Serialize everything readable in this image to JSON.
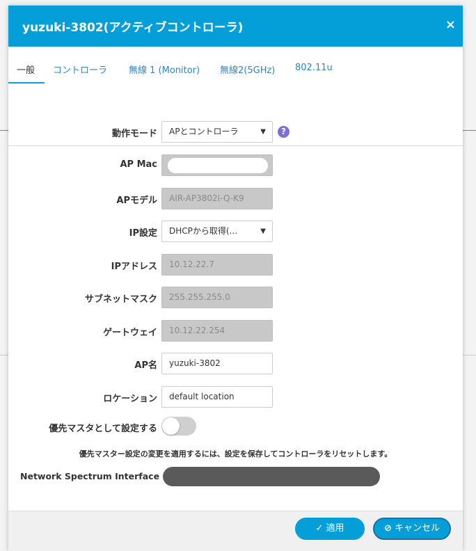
{
  "dialog": {
    "title": "yuzuki-3802(アクティブコントローラ)",
    "close_icon": "×"
  },
  "tabs": [
    {
      "label": "一般",
      "active": true
    },
    {
      "label": "コントローラ"
    },
    {
      "label": "無線 1 (Monitor)"
    },
    {
      "label": "無線2(5GHz)"
    },
    {
      "label": "802.11u"
    }
  ],
  "form": {
    "operation_mode": {
      "label": "動作モード",
      "value": "APとコントローラ"
    },
    "help_icon": "?",
    "ap_mac": {
      "label": "AP Mac",
      "value": ""
    },
    "ap_model": {
      "label": "APモデル",
      "value": "AIR-AP3802I-Q-K9"
    },
    "ip_setting": {
      "label": "IP設定",
      "value": "DHCPから取得(..."
    },
    "ip_address": {
      "label": "IPアドレス",
      "value": "10.12.22.7"
    },
    "subnet_mask": {
      "label": "サブネットマスク",
      "value": "255.255.255.0"
    },
    "gateway": {
      "label": "ゲートウェイ",
      "value": "10.12.22.254"
    },
    "ap_name": {
      "label": "AP名",
      "value": "yuzuki-3802"
    },
    "location": {
      "label": "ロケーション",
      "value": "default location"
    },
    "preferred_master": {
      "label": "優先マスタとして設定する",
      "enabled": false
    },
    "note": "優先マスター設定の変更を適用するには、設定を保存してコントローラをリセットします。",
    "network_spectrum_interface": {
      "label": "Network Spectrum Interface",
      "value": ""
    }
  },
  "footer": {
    "apply_icon": "✓",
    "apply_label": "適用",
    "cancel_icon": "⊘",
    "cancel_label": "キャンセル"
  },
  "colors": {
    "header": "#049fd9",
    "tab_link": "#2b87c6",
    "help_icon": "#7b70d6",
    "button": "#049fd9"
  }
}
